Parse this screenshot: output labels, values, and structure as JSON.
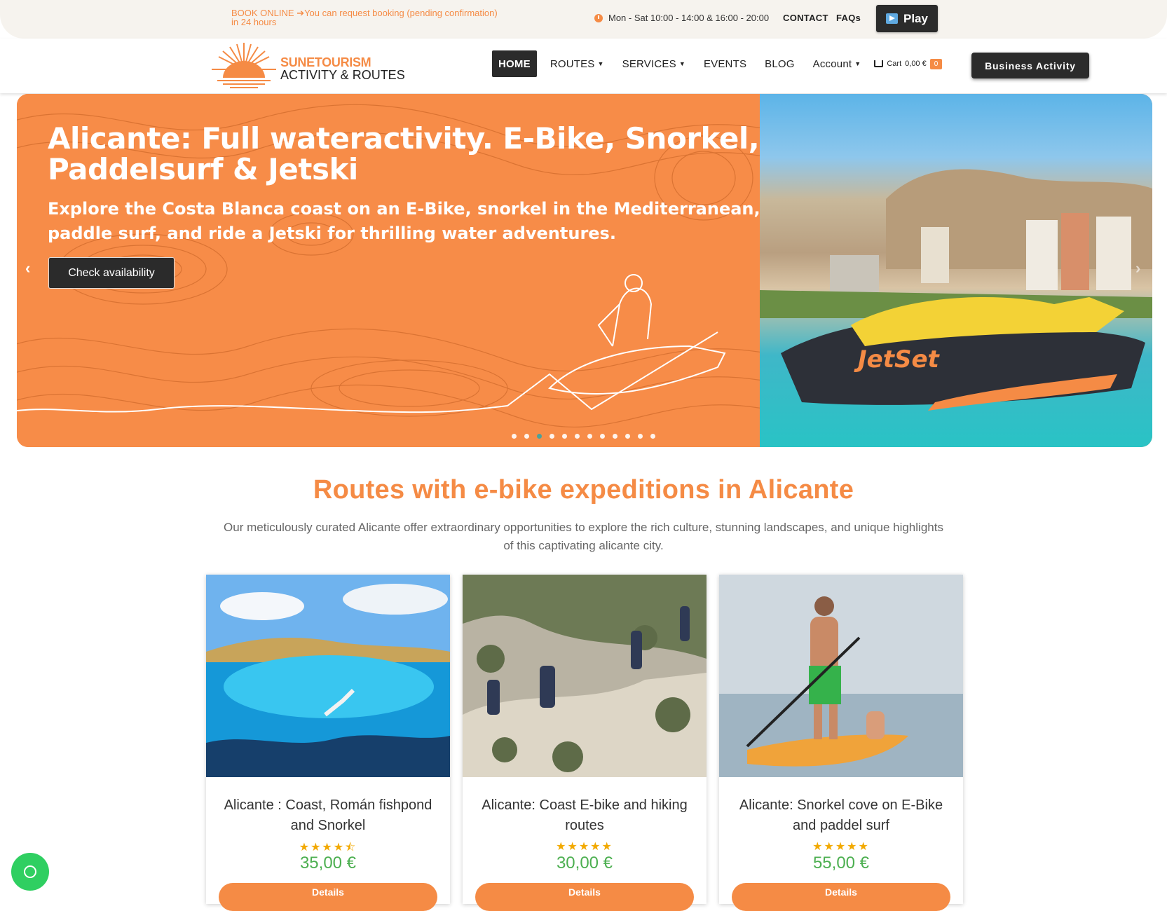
{
  "topbar": {
    "booking_text": "BOOK ONLINE ➔You can request booking (pending confirmation) in 24 hours",
    "hours": "Mon - Sat 10:00 - 14:00 & 16:00 - 20:00",
    "contact": "CONTACT",
    "faqs": "FAQs",
    "play": "Play"
  },
  "logo": {
    "line1": "SUNETOURISM",
    "line2": "ACTIVITY & ROUTES"
  },
  "nav": {
    "home": "HOME",
    "routes": "ROUTES",
    "services": "SERVICES",
    "events": "EVENTS",
    "blog": "BLOG",
    "account": "Account",
    "cart_label": "Cart",
    "cart_amount": "0,00 €",
    "cart_count": "0",
    "business": "Business Activity"
  },
  "hero": {
    "title": "Alicante: Full wateractivity. E-Bike, Snorkel, Paddelsurf & Jetski",
    "subtitle": "Explore the Costa Blanca coast on an E-Bike, snorkel in the Mediterranean, paddle surf, and ride a Jetski for thrilling water adventures.",
    "cta": "Check availability",
    "slide_count": 12,
    "active_slide": 3
  },
  "section": {
    "title": "Routes with e-bike expeditions in Alicante",
    "description": "Our meticulously curated Alicante offer extraordinary opportunities to explore the rich culture, stunning landscapes, and unique highlights of this captivating alicante city."
  },
  "cards": [
    {
      "title": "Alicante : Coast, Román fishpond and Snorkel",
      "rating": 4.5,
      "stars": "★★★★⯪",
      "price": "35,00 €",
      "details": "Details"
    },
    {
      "title": "Alicante: Coast E-bike and hiking routes",
      "rating": 5,
      "stars": "★★★★★",
      "price": "30,00 €",
      "details": "Details"
    },
    {
      "title": "Alicante: Snorkel cove on E-Bike and paddel surf",
      "rating": 5,
      "stars": "★★★★★",
      "price": "55,00 €",
      "details": "Details"
    }
  ],
  "colors": {
    "accent": "#f58b45",
    "dark": "#2b2b2b",
    "price": "#4caf50",
    "whatsapp": "#2fcf61"
  }
}
